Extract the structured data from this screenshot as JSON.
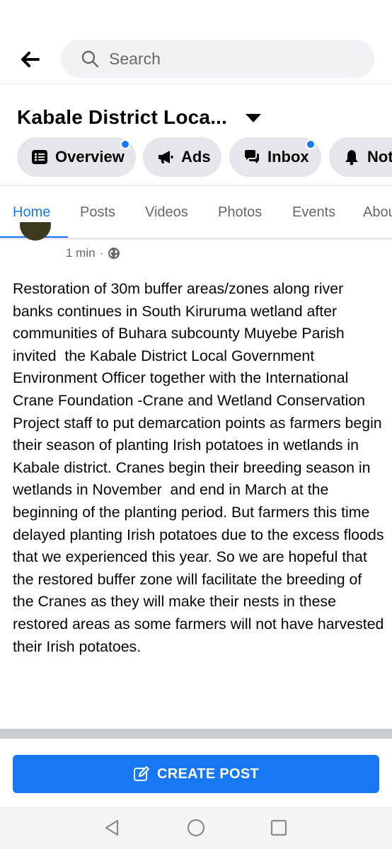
{
  "header": {
    "search": {
      "placeholder": "Search"
    }
  },
  "page": {
    "title": "Kabale District Loca..."
  },
  "actions": [
    {
      "label": "Overview",
      "icon": "list-icon",
      "has_dot": true
    },
    {
      "label": "Ads",
      "icon": "megaphone-icon",
      "has_dot": false
    },
    {
      "label": "Inbox",
      "icon": "chat-icon",
      "has_dot": true
    },
    {
      "label": "Not",
      "icon": "bell-icon",
      "has_dot": false
    }
  ],
  "tabs": [
    "Home",
    "Posts",
    "Videos",
    "Photos",
    "Events",
    "Abou"
  ],
  "active_tab": "Home",
  "post": {
    "time": "1 min",
    "separator": "·",
    "audience_icon": "globe-icon",
    "text": "Restoration of 30m buffer areas/zones along river banks continues in South Kiruruma wetland after  communities of Buhara subcounty Muyebe Parish invited  the Kabale District Local Government Environment Officer together with the International Crane Foundation -Crane and Wetland Conservation Project staff to put demarcation points as farmers begin their season of planting Irish potatoes in wetlands in Kabale district. Cranes begin their breeding season in wetlands in November  and end in March at the beginning of the planting period. But farmers this time delayed planting Irish potatoes due to the excess floods that we experienced this year. So we are hopeful that the restored buffer zone will facilitate the breeding of the Cranes as they will make their nests in these restored areas as some farmers will not have harvested their Irish potatoes."
  },
  "create_post": {
    "label": "CREATE POST",
    "icon": "edit-icon"
  },
  "system_nav": [
    "back-triangle-icon",
    "home-circle-icon",
    "recents-square-icon"
  ],
  "colors": {
    "accent": "#1877f2",
    "chip_bg": "#e4e6eb",
    "search_bg": "#f0f2f5",
    "muted_text": "#65676b"
  }
}
